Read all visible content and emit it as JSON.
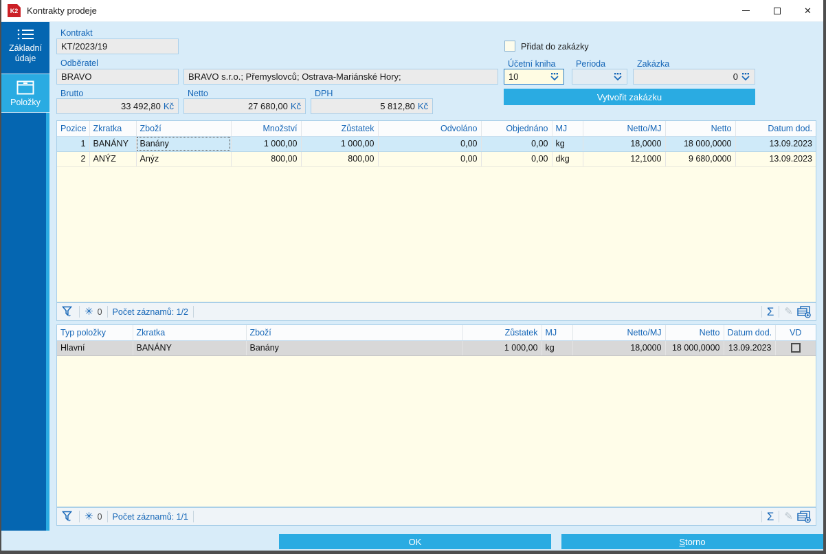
{
  "window": {
    "title": "Kontrakty prodeje",
    "app_logo": "K2"
  },
  "sidebar": {
    "items": [
      {
        "label": "Základní údaje",
        "icon": "list-icon",
        "selected": false
      },
      {
        "label": "Položky",
        "icon": "box-icon",
        "selected": true
      }
    ]
  },
  "form": {
    "kontrakt": {
      "label": "Kontrakt",
      "value": "KT/2023/19"
    },
    "odberatel": {
      "label": "Odběratel",
      "value": "BRAVO"
    },
    "adresa": {
      "value": "BRAVO s.r.o.; Přemyslovců; Ostrava-Mariánské Hory;"
    },
    "pridat_do_zakazky": {
      "label": "Přidat do zakázky",
      "checked": false
    },
    "ucetni_kniha": {
      "label": "Účetní kniha",
      "value": "10"
    },
    "perioda": {
      "label": "Perioda",
      "value": ""
    },
    "zakazka": {
      "label": "Zakázka",
      "value": "0"
    },
    "brutto": {
      "label": "Brutto",
      "value": "33 492,80",
      "unit": "Kč"
    },
    "netto": {
      "label": "Netto",
      "value": "27 680,00",
      "unit": "Kč"
    },
    "dph": {
      "label": "DPH",
      "value": "5 812,80",
      "unit": "Kč"
    },
    "vytvorit_zakazku_label": "Vytvořit zakázku"
  },
  "table1": {
    "columns": [
      "Pozice",
      "Zkratka",
      "Zboží",
      "Množství",
      "Zůstatek",
      "Odvoláno",
      "Objednáno",
      "MJ",
      "Netto/MJ",
      "Netto",
      "Datum dod."
    ],
    "rows": [
      [
        "1",
        "BANÁNY",
        "Banány",
        "1 000,00",
        "1 000,00",
        "0,00",
        "0,00",
        "kg",
        "18,0000",
        "18 000,0000",
        "13.09.2023"
      ],
      [
        "2",
        "ANÝZ",
        "Anýz",
        "800,00",
        "800,00",
        "0,00",
        "0,00",
        "dkg",
        "12,1000",
        "9 680,0000",
        "13.09.2023"
      ]
    ],
    "selected_row": 0,
    "focused_cell_col": 2,
    "status": {
      "frozen_count": "0",
      "records": "Počet záznamů: 1/2"
    }
  },
  "table2": {
    "columns": [
      "Typ položky",
      "Zkratka",
      "Zboží",
      "Zůstatek",
      "MJ",
      "Netto/MJ",
      "Netto",
      "Datum dod.",
      "VD"
    ],
    "rows": [
      [
        "Hlavní",
        "BANÁNY",
        "Banány",
        "1 000,00",
        "kg",
        "18,0000",
        "18 000,0000",
        "13.09.2023",
        ""
      ]
    ],
    "selected_row": 0,
    "vd_checked": false,
    "status": {
      "frozen_count": "0",
      "records": "Počet záznamů: 1/1"
    }
  },
  "footer": {
    "ok_label": "OK",
    "storno_label": "Storno"
  },
  "colors": {
    "accent_cyan": "#2aabe2",
    "sidebar_blue": "#0566b1",
    "label_blue": "#1566b7",
    "selection_blue": "#cfeaf9",
    "selection_gray": "#d8d8d8",
    "table_cream": "#fffde9",
    "app_red": "#cc2026"
  }
}
